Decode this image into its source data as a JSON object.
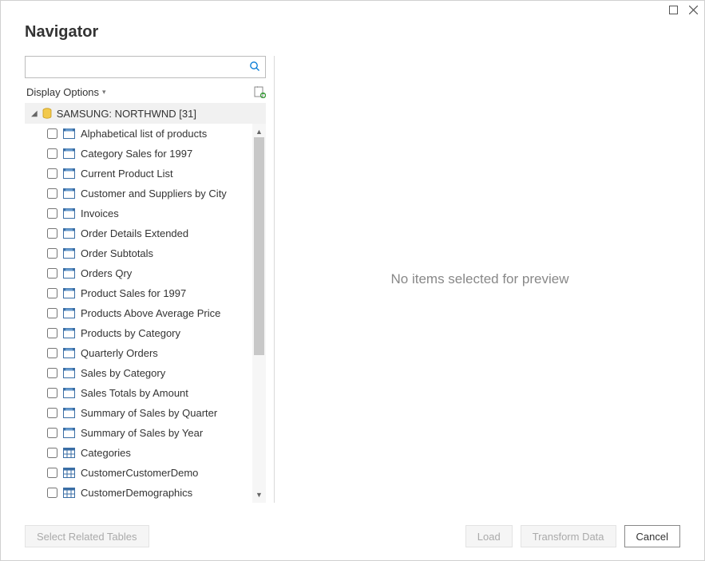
{
  "title": "Navigator",
  "search": {
    "placeholder": ""
  },
  "display_options_label": "Display Options",
  "database": {
    "name": "SAMSUNG: NORTHWND [31]"
  },
  "items": [
    {
      "label": "Alphabetical list of products",
      "type": "view"
    },
    {
      "label": "Category Sales for 1997",
      "type": "view"
    },
    {
      "label": "Current Product List",
      "type": "view"
    },
    {
      "label": "Customer and Suppliers by City",
      "type": "view"
    },
    {
      "label": "Invoices",
      "type": "view"
    },
    {
      "label": "Order Details Extended",
      "type": "view"
    },
    {
      "label": "Order Subtotals",
      "type": "view"
    },
    {
      "label": "Orders Qry",
      "type": "view"
    },
    {
      "label": "Product Sales for 1997",
      "type": "view"
    },
    {
      "label": "Products Above Average Price",
      "type": "view"
    },
    {
      "label": "Products by Category",
      "type": "view"
    },
    {
      "label": "Quarterly Orders",
      "type": "view"
    },
    {
      "label": "Sales by Category",
      "type": "view"
    },
    {
      "label": "Sales Totals by Amount",
      "type": "view"
    },
    {
      "label": "Summary of Sales by Quarter",
      "type": "view"
    },
    {
      "label": "Summary of Sales by Year",
      "type": "view"
    },
    {
      "label": "Categories",
      "type": "table"
    },
    {
      "label": "CustomerCustomerDemo",
      "type": "table"
    },
    {
      "label": "CustomerDemographics",
      "type": "table"
    }
  ],
  "preview_message": "No items selected for preview",
  "buttons": {
    "select_related": "Select Related Tables",
    "load": "Load",
    "transform": "Transform Data",
    "cancel": "Cancel"
  }
}
